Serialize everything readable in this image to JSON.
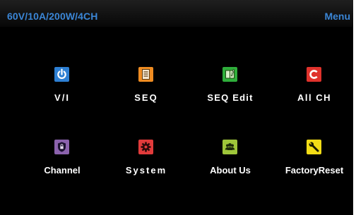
{
  "header": {
    "title": "60V/10A/200W/4CH",
    "menu_label": "Menu"
  },
  "tiles": [
    {
      "label": "V/I",
      "icon": "power-icon",
      "color": "#2d7fd3"
    },
    {
      "label": "SEQ",
      "icon": "document-icon",
      "color": "#ef8c22"
    },
    {
      "label": "SEQ Edit",
      "icon": "edit-document-icon",
      "color": "#2fae3b"
    },
    {
      "label": "All CH",
      "icon": "channel-c-icon",
      "color": "#e0322c"
    },
    {
      "label": "Channel",
      "icon": "channel-lock-icon",
      "color": "#8b62ad"
    },
    {
      "label": "System",
      "icon": "gear-icon",
      "color": "#e13b3b"
    },
    {
      "label": "About Us",
      "icon": "people-icon",
      "color": "#9ec63a"
    },
    {
      "label": "FactoryReset",
      "icon": "wrench-icon",
      "color": "#f2dc16"
    }
  ]
}
